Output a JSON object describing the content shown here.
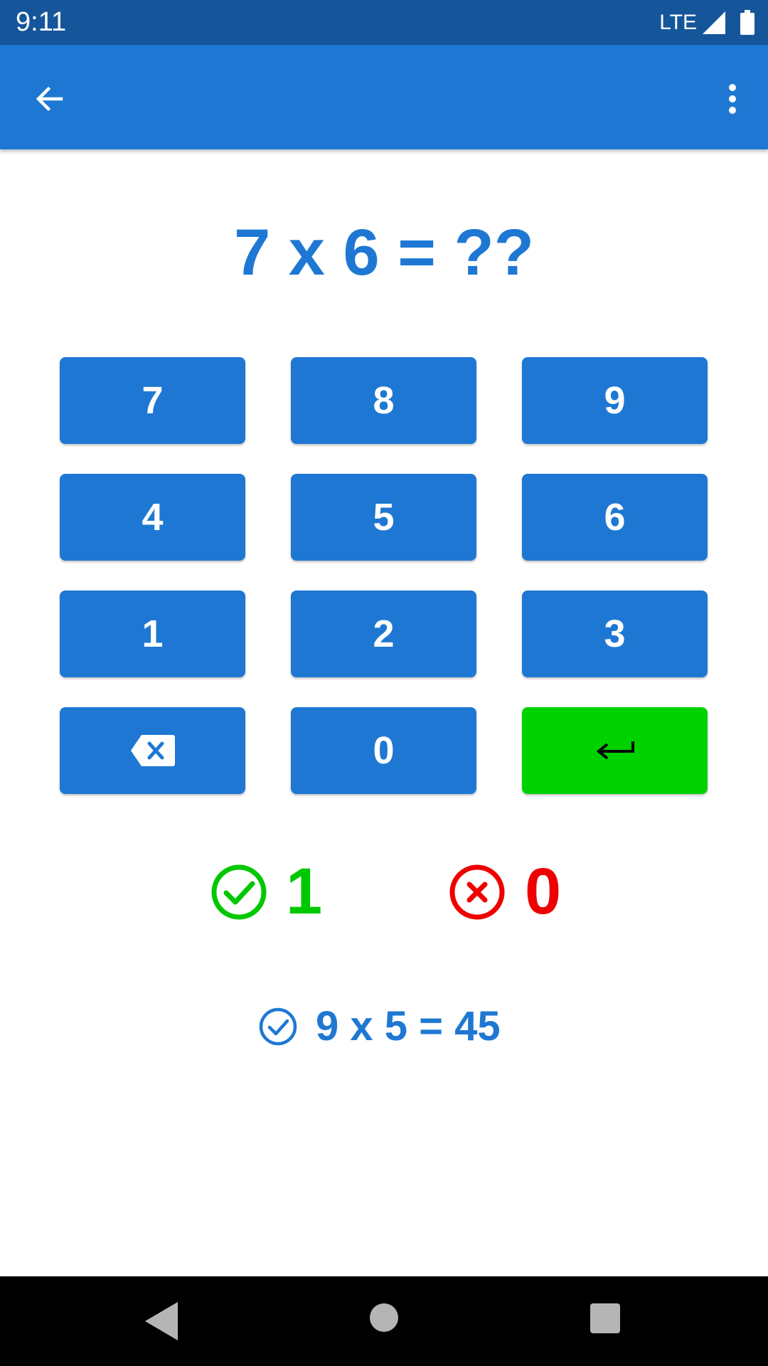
{
  "status_bar": {
    "time": "9:11",
    "network": "LTE",
    "icons": [
      "signal-icon",
      "battery-icon"
    ]
  },
  "app_bar": {
    "color": "#1e78d3",
    "icons": [
      "arrow-back-icon",
      "more-vert-icon"
    ]
  },
  "question": {
    "text": "7 x 6 = ??"
  },
  "keypad": {
    "keys": [
      "7",
      "8",
      "9",
      "4",
      "5",
      "6",
      "1",
      "2",
      "3",
      "",
      "0",
      ""
    ],
    "backspace_icon": "backspace-icon",
    "enter_icon": "enter-arrow-icon",
    "enter_color": "#00d200",
    "key_color": "#1e78d3"
  },
  "score": {
    "correct": "1",
    "wrong": "0",
    "correct_color": "#00c800",
    "wrong_color": "#ee0000"
  },
  "last_answer": {
    "text": "9 x 5 = 45",
    "icon": "check-circle-outline-icon"
  },
  "nav_bar": {
    "icons": [
      "nav-back-icon",
      "nav-home-icon",
      "nav-recents-icon"
    ]
  }
}
